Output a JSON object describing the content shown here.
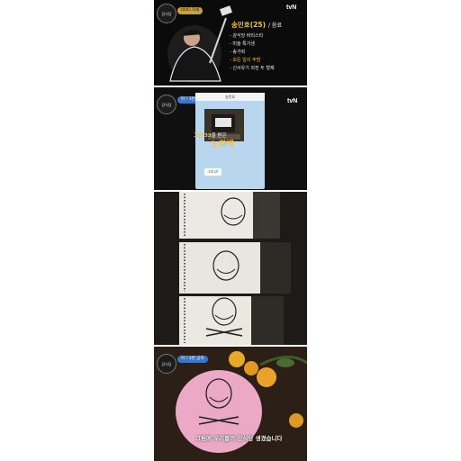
{
  "panel1": {
    "logo": "강식당",
    "tag": "OOO 자세",
    "channel": "tvN",
    "profile_name": "송민호(25)",
    "profile_role": "/ 음료",
    "traits": [
      "- 강식당 바리스타",
      "- 미술 특기생",
      "- 송가락",
      "- 모든 일의 주범",
      "- 신서유기 외전 두 형제"
    ],
    "highlight_index": 3
  },
  "panel2": {
    "logo": "강식당",
    "tag": "아 ! 3번 공지",
    "channel": "tvN",
    "chat_header": "송민호",
    "chat_bubble": "그리고!",
    "caption_pre": "그림 33",
    "caption_mid": "을 받은",
    "caption_big": "노화백"
  },
  "panel4": {
    "logo": "강식당",
    "tag": "아 ! 3번 공지",
    "subtitle": "그림에 우리들의 강식당 생겼습니다"
  },
  "colors": {
    "gold": "#f2c53c",
    "blue": "#3b76c9",
    "pink": "#eba9c6"
  }
}
